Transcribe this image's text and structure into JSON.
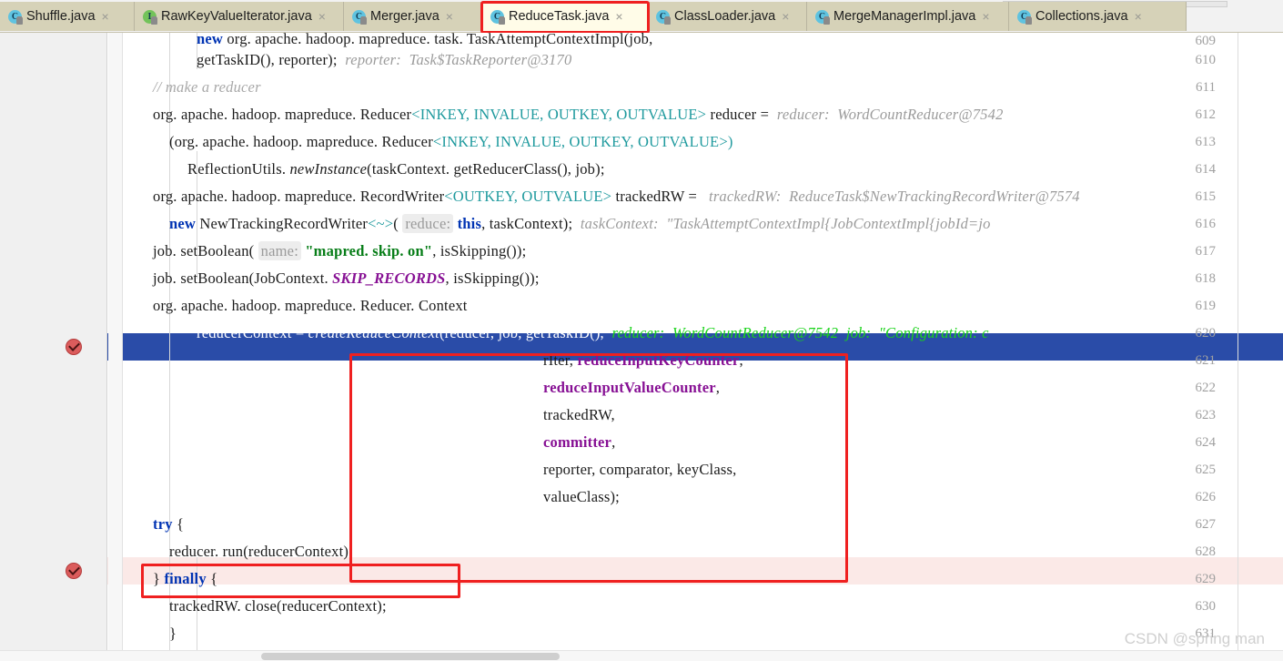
{
  "window": {
    "app": "IntelliJ IDEA Java Editor",
    "watermark": "CSDN @spring man"
  },
  "tabs": [
    {
      "label": "Shuffle.java",
      "icon": "java-class-icon",
      "kind": "class",
      "active": false,
      "close": "×"
    },
    {
      "label": "RawKeyValueIterator.java",
      "icon": "java-interface-icon",
      "kind": "interface",
      "active": false,
      "close": "×"
    },
    {
      "label": "Merger.java",
      "icon": "java-class-icon",
      "kind": "class",
      "active": false,
      "close": "×"
    },
    {
      "label": "ReduceTask.java",
      "icon": "java-class-icon",
      "kind": "class",
      "active": true,
      "close": "×"
    },
    {
      "label": "ClassLoader.java",
      "icon": "java-class-icon",
      "kind": "class",
      "active": false,
      "close": "×"
    },
    {
      "label": "MergeManagerImpl.java",
      "icon": "java-class-icon",
      "kind": "class",
      "active": false,
      "close": "×"
    },
    {
      "label": "Collections.java",
      "icon": "java-class-icon",
      "kind": "class",
      "active": false,
      "close": "×"
    }
  ],
  "gutter": {
    "line_numbers": [
      "609",
      "610",
      "611",
      "612",
      "613",
      "614",
      "615",
      "616",
      "617",
      "618",
      "619",
      "620",
      "621",
      "622",
      "623",
      "624",
      "625",
      "626",
      "627",
      "628",
      "629",
      "630",
      "631"
    ],
    "breakpoint_lines": [
      "620",
      "628"
    ]
  },
  "code": {
    "l609": {
      "kw1": "new",
      "t1": " org. apache. hadoop. mapreduce. task. TaskAttemptContextImpl(job,"
    },
    "l610": {
      "t1": "getTaskID(), reporter);",
      "hint": "reporter:  Task$TaskReporter@3170"
    },
    "l611": {
      "cmt": "// make a reducer"
    },
    "l612": {
      "t1": "org. apache. hadoop. mapreduce. Reducer",
      "lt": "<",
      "gen": "INKEY, INVALUE, OUTKEY, OUTVALUE",
      "gt": "> ",
      "t2": "reducer =",
      "hint": "reducer:  WordCountReducer@7542"
    },
    "l613": {
      "t1": "(org. apache. hadoop. mapreduce. Reducer",
      "lt": "<",
      "gen": "INKEY, INVALUE, OUTKEY, OUTVALUE",
      "gt": ">)"
    },
    "l614": {
      "t1": "ReflectionUtils. ",
      "mth": "newInstance",
      "t2": "(taskContext. getReducerClass(), job);"
    },
    "l615": {
      "t1": "org. apache. hadoop. mapreduce. RecordWriter",
      "lt": "<",
      "gen": "OUTKEY, OUTVALUE",
      "gt": "> ",
      "t2": "trackedRW =",
      "hint": "trackedRW:  ReduceTask$NewTrackingRecordWriter@7574"
    },
    "l616": {
      "kw": "new",
      "t1": " NewTrackingRecordWriter",
      "gen": "<~>",
      "t2": "( ",
      "phint": "reduce:",
      "kw2": " this",
      "t3": ", taskContext);",
      "hint": "taskContext:  \"TaskAttemptContextImpl{JobContextImpl{jobId=jo"
    },
    "l617": {
      "t1": "job. setBoolean( ",
      "phint": "name:",
      "str": " \"mapred. skip. on\"",
      "t2": ", isSkipping());"
    },
    "l618": {
      "t1": "job. setBoolean(JobContext. ",
      "stat": "SKIP_RECORDS",
      "t2": ", isSkipping());"
    },
    "l619": {
      "t1": "org. apache. hadoop. mapreduce. Reducer. Context"
    },
    "l620": {
      "t1": "reducerContext = ",
      "mth": "createReduceContext",
      "t2": "(reducer, job, getTaskID(),",
      "hint1": "reducer:  WordCountReducer@7542",
      "hint2": "job:  \"Configuration: c"
    },
    "l621": {
      "t1": "rIter, ",
      "fld": "reduceInputKeyCounter",
      "t2": ","
    },
    "l622": {
      "fld": "reduceInputValueCounter",
      "t2": ","
    },
    "l623": {
      "t1": "trackedRW,"
    },
    "l624": {
      "fld": "committer",
      "t2": ","
    },
    "l625": {
      "t1": "reporter, comparator, keyClass,"
    },
    "l626": {
      "t1": "valueClass);"
    },
    "l627": {
      "kw": "try",
      "t1": " {"
    },
    "l628": {
      "t1": "reducer. run(reducerContext);"
    },
    "l629": {
      "t1": "} ",
      "kw": "finally",
      "t2": " {"
    },
    "l630": {
      "t1": "trackedRW. close(reducerContext);"
    },
    "l631": {
      "t1": "}"
    }
  },
  "annotations": {
    "tab_highlight": "ReduceTask.java",
    "box_args": "createReduceContext argument list",
    "box_run": "reducer.run(reducerContext);"
  },
  "colors": {
    "accent_red": "#ef2020",
    "selection_blue": "#2a4ca8",
    "breakpoint_line": "#fbe9e7",
    "keyword": "#0033b3",
    "generic": "#1f9a9e",
    "string": "#067d17",
    "field": "#871094",
    "hint_gray": "#9b9b9b",
    "hint_green": "#19d319",
    "tab_bg": "#d6d2b8",
    "tab_active_bg": "#fffce8"
  }
}
